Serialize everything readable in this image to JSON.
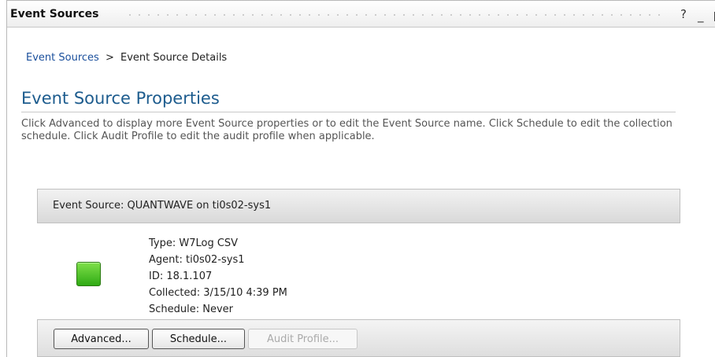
{
  "window": {
    "title": "Event Sources",
    "help_label": "?",
    "minimize_label": "_"
  },
  "breadcrumb": {
    "link_label": "Event Sources",
    "separator": ">",
    "current": "Event Source Details"
  },
  "page": {
    "title": "Event Source Properties",
    "description": "Click Advanced to display more Event Source properties or to edit the Event Source name. Click Schedule to edit the collection schedule. Click Audit Profile to edit the audit profile when applicable."
  },
  "event_source": {
    "header": "Event Source: QUANTWAVE on ti0s02-sys1",
    "status_icon": "green-status-icon",
    "status_color": "#3cc01e",
    "details": [
      "Type: W7Log CSV",
      "Agent: ti0s02-sys1",
      "ID: 18.1.107",
      "Collected: 3/15/10 4:39 PM",
      "Schedule: Never"
    ]
  },
  "buttons": {
    "advanced": "Advanced...",
    "schedule": "Schedule...",
    "audit_profile": "Audit Profile..."
  },
  "colors": {
    "title_blue": "#1d5c8e",
    "link_blue": "#1a4f9c"
  }
}
